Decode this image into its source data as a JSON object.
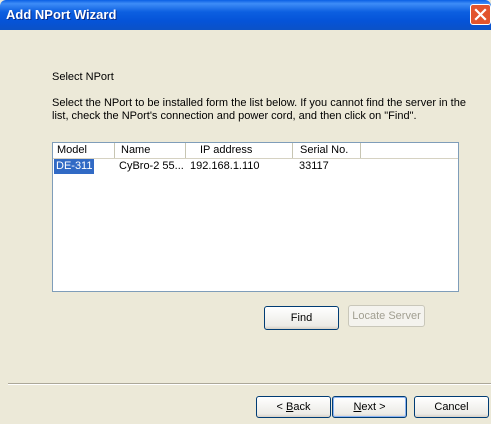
{
  "window": {
    "title": "Add NPort Wizard"
  },
  "section": {
    "heading": "Select NPort",
    "description": "Select the NPort to be installed form the list below. If you cannot find the server in the list, check the NPort's connection and power cord, and then click on \"Find\"."
  },
  "list": {
    "columns": [
      "Model",
      "Name",
      "IP address",
      "Serial No."
    ],
    "rows": [
      {
        "model": "DE-311",
        "name": "CyBro-2 55...",
        "ip": "192.168.1.110",
        "serial": "33117"
      }
    ]
  },
  "buttons": {
    "find": "Find",
    "locate": "Locate Server",
    "back_prefix": "< ",
    "back_key": "B",
    "back_rest": "ack",
    "next_key": "N",
    "next_rest": "ext >",
    "cancel": "Cancel"
  },
  "colors": {
    "title_bar": "#0553D8",
    "selection": "#316AC5",
    "dialog_bg": "#ECE9D8"
  }
}
